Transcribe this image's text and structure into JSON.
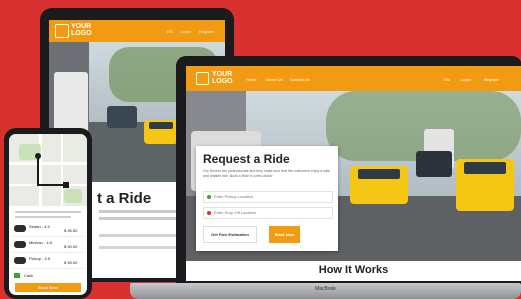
{
  "brand": {
    "logo_line1": "YOUR",
    "logo_line2": "LOGO"
  },
  "nav": {
    "home": "Home",
    "about": "About Us",
    "contact": "Contact Us",
    "lang": "EN",
    "login": "Login",
    "register": "Register"
  },
  "hero": {
    "title": "Request a Ride",
    "tablet_title_fragment": "t a Ride",
    "description": "Our Drivers are professionals and they make sure that the customers enjoy a safe and reliable ride. Book a Ride in a few clicks!",
    "pickup_placeholder": "Enter Pickup Location",
    "dropoff_placeholder": "Enter Drop Off Location",
    "fare_button": "Get Fare Estimation",
    "book_button": "Book Now"
  },
  "section": {
    "how_it_works": "How It Works"
  },
  "device": {
    "laptop_label": "MacBook"
  },
  "phone": {
    "rides": [
      {
        "name": "Sedan - 4.5",
        "price": "$ 26.50"
      },
      {
        "name": "Minivan - 4.5",
        "price": "$ 30.00"
      },
      {
        "name": "Pickup - 4.5",
        "price": "$ 45.00"
      }
    ],
    "cash_label": "Cash",
    "book_button": "Book Now"
  },
  "colors": {
    "background": "#d8302f",
    "accent": "#f39a13",
    "taxi": "#f5c614"
  }
}
